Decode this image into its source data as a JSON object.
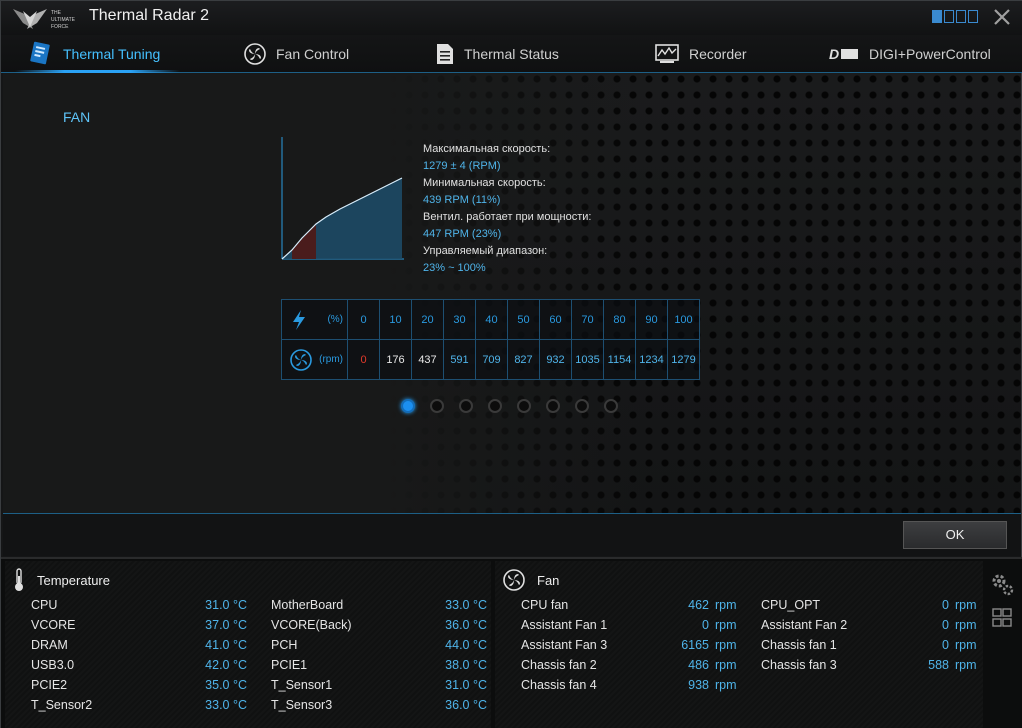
{
  "window": {
    "title": "Thermal Radar 2"
  },
  "tabs": [
    {
      "label": "Thermal Tuning",
      "icon": "thermal-tuning-icon",
      "active": true
    },
    {
      "label": "Fan Control",
      "icon": "fan-control-icon",
      "active": false
    },
    {
      "label": "Thermal Status",
      "icon": "document-icon",
      "active": false
    },
    {
      "label": "Recorder",
      "icon": "recorder-icon",
      "active": false
    },
    {
      "label": "DIGI+PowerControl",
      "icon": "digi-icon",
      "active": false
    }
  ],
  "tuning": {
    "section": "FAN",
    "info": {
      "max_label": "Максимальная скорость:",
      "max_value": "1279 ± 4 (RPM)",
      "min_label": "Минимальная скорость:",
      "min_value": "439 RPM (11%)",
      "start_label": "Вентил. работает при мощности:",
      "start_value": "447 RPM (23%)",
      "range_label": "Управляемый диапазон:",
      "range_value": "23% ~ 100%"
    },
    "table": {
      "power_unit": "(%)",
      "rpm_unit": "(rpm)",
      "percent": [
        "0",
        "10",
        "20",
        "30",
        "40",
        "50",
        "60",
        "70",
        "80",
        "90",
        "100"
      ],
      "rpm": [
        "0",
        "176",
        "437",
        "591",
        "709",
        "827",
        "932",
        "1035",
        "1154",
        "1234",
        "1279"
      ]
    },
    "pager": {
      "count": 8,
      "active": 0
    },
    "ok_label": "OK"
  },
  "temperature": {
    "title": "Temperature",
    "col1": [
      {
        "name": "CPU",
        "value": "31.0 °C"
      },
      {
        "name": "VCORE",
        "value": "37.0 °C"
      },
      {
        "name": "DRAM",
        "value": "41.0 °C"
      },
      {
        "name": "USB3.0",
        "value": "42.0 °C"
      },
      {
        "name": "PCIE2",
        "value": "35.0 °C"
      },
      {
        "name": "T_Sensor2",
        "value": "33.0 °C"
      }
    ],
    "col2": [
      {
        "name": "MotherBoard",
        "value": "33.0 °C"
      },
      {
        "name": "VCORE(Back)",
        "value": "36.0 °C"
      },
      {
        "name": "PCH",
        "value": "44.0 °C"
      },
      {
        "name": "PCIE1",
        "value": "38.0 °C"
      },
      {
        "name": "T_Sensor1",
        "value": "31.0 °C"
      },
      {
        "name": "T_Sensor3",
        "value": "36.0 °C"
      }
    ]
  },
  "fan": {
    "title": "Fan",
    "unit": "rpm",
    "col1": [
      {
        "name": "CPU fan",
        "value": "462"
      },
      {
        "name": "Assistant Fan 1",
        "value": "0"
      },
      {
        "name": "Assistant Fan 3",
        "value": "6165"
      },
      {
        "name": "Chassis fan 2",
        "value": "486"
      },
      {
        "name": "Chassis fan 4",
        "value": "938"
      }
    ],
    "col2": [
      {
        "name": "CPU_OPT",
        "value": "0"
      },
      {
        "name": "Assistant Fan 2",
        "value": "0"
      },
      {
        "name": "Chassis fan 1",
        "value": "0"
      },
      {
        "name": "Chassis fan 3",
        "value": "588"
      }
    ]
  },
  "colors": {
    "accent": "#2aa2f5",
    "value_blue": "#4fb4ea",
    "warning_red": "#e23a2a"
  }
}
